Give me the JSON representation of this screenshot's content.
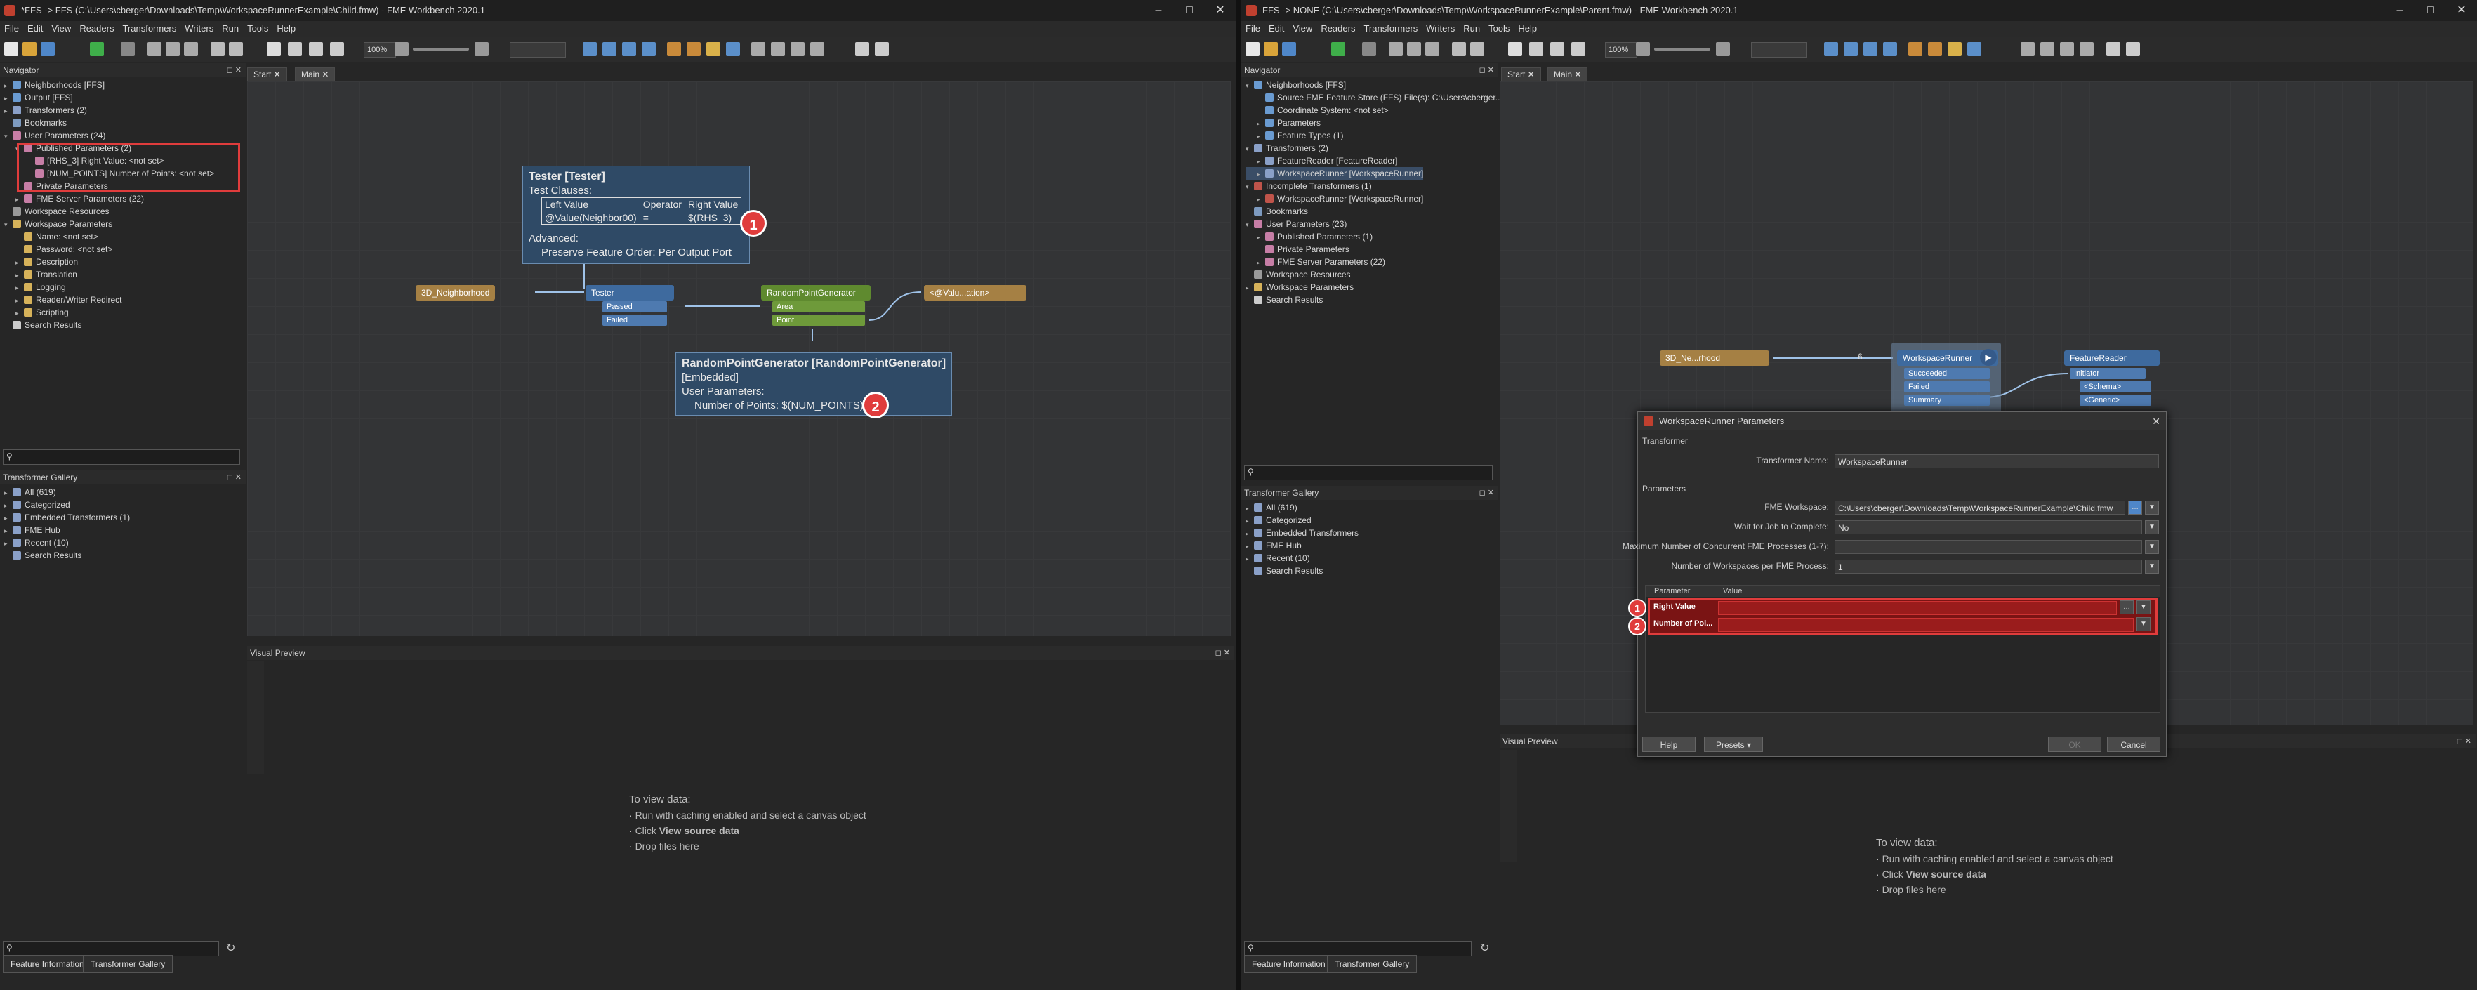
{
  "left": {
    "title": "*FFS -> FFS (C:\\Users\\cberger\\Downloads\\Temp\\WorkspaceRunnerExample\\Child.fmw) - FME Workbench 2020.1",
    "menu": [
      "File",
      "Edit",
      "View",
      "Readers",
      "Transformers",
      "Writers",
      "Run",
      "Tools",
      "Help"
    ],
    "zoom": "100%",
    "navigator_title": "Navigator",
    "nav": [
      {
        "label": "Neighborhoods [FFS]",
        "indent": 0,
        "arrow": "▸",
        "color": "#6a9bd1"
      },
      {
        "label": "Output [FFS]",
        "indent": 0,
        "arrow": "▸",
        "color": "#6a9bd1"
      },
      {
        "label": "Transformers (2)",
        "indent": 0,
        "arrow": "▸",
        "color": "#8aa0c8"
      },
      {
        "label": "Bookmarks",
        "indent": 0,
        "arrow": "",
        "color": "#7d9abf"
      },
      {
        "label": "User Parameters (24)",
        "indent": 0,
        "arrow": "▾",
        "color": "#c77ea6"
      },
      {
        "label": "Published Parameters (2)",
        "indent": 1,
        "arrow": "▾",
        "color": "#c77ea6"
      },
      {
        "label": "[RHS_3] Right Value: <not set>",
        "indent": 2,
        "arrow": "",
        "color": "#c77ea6"
      },
      {
        "label": "[NUM_POINTS] Number of Points: <not set>",
        "indent": 2,
        "arrow": "",
        "color": "#c77ea6"
      },
      {
        "label": "Private Parameters",
        "indent": 1,
        "arrow": "",
        "color": "#c77ea6"
      },
      {
        "label": "FME Server Parameters (22)",
        "indent": 1,
        "arrow": "▸",
        "color": "#c77ea6"
      },
      {
        "label": "Workspace Resources",
        "indent": 0,
        "arrow": "",
        "color": "#9a9a9a"
      },
      {
        "label": "Workspace Parameters",
        "indent": 0,
        "arrow": "▾",
        "color": "#d6b25a"
      },
      {
        "label": "Name: <not set>",
        "indent": 1,
        "arrow": "",
        "color": "#d6b25a"
      },
      {
        "label": "Password: <not set>",
        "indent": 1,
        "arrow": "",
        "color": "#d6b25a"
      },
      {
        "label": "Description",
        "indent": 1,
        "arrow": "▸",
        "color": "#d6b25a"
      },
      {
        "label": "Translation",
        "indent": 1,
        "arrow": "▸",
        "color": "#d6b25a"
      },
      {
        "label": "Logging",
        "indent": 1,
        "arrow": "▸",
        "color": "#d6b25a"
      },
      {
        "label": "Reader/Writer Redirect",
        "indent": 1,
        "arrow": "▸",
        "color": "#d6b25a"
      },
      {
        "label": "Scripting",
        "indent": 1,
        "arrow": "▸",
        "color": "#d6b25a"
      },
      {
        "label": "Search Results",
        "indent": 0,
        "arrow": "",
        "color": "#cccccc"
      }
    ],
    "gallery_title": "Transformer Gallery",
    "gallery": [
      {
        "label": "All (619)",
        "arrow": "▸"
      },
      {
        "label": "Categorized",
        "arrow": "▸"
      },
      {
        "label": "Embedded Transformers (1)",
        "arrow": "▸"
      },
      {
        "label": "FME Hub",
        "arrow": "▸"
      },
      {
        "label": "Recent (10)",
        "arrow": "▸"
      },
      {
        "label": "Search Results",
        "arrow": ""
      }
    ],
    "tabs": [
      "Start",
      "Main"
    ],
    "tester_ann": {
      "title": "Tester [Tester]",
      "clauses_label": "Test Clauses:",
      "headers": [
        "Left Value",
        "Operator",
        "Right Value"
      ],
      "row": [
        "@Value(Neighbor00)",
        "=",
        "$(RHS_3)"
      ],
      "advanced": "Advanced:",
      "preserve": "Preserve Feature Order: Per Output Port",
      "badge": "1"
    },
    "rpg_ann": {
      "title": "RandomPointGenerator [RandomPointGenerator]",
      "embedded": "[Embedded]",
      "user_params": "User Parameters:",
      "num_points": "Number of Points: $(NUM_POINTS)",
      "badge": "2"
    },
    "nodes": {
      "neighborhood": "3D_Neighborhood",
      "tester": "Tester",
      "passed": "Passed",
      "failed": "Failed",
      "rpg": "RandomPointGenerator",
      "area": "Area",
      "point": "Point",
      "writer": "<@Valu...ation>"
    },
    "visual_preview_title": "Visual Preview",
    "vp": {
      "heading": "To view data:",
      "l1": "Run with caching enabled and select a canvas object",
      "l2a": "Click",
      "l2b": "View source data",
      "l3": "Drop files here"
    },
    "bottom_tabs": [
      "Feature Information",
      "Transformer Gallery"
    ]
  },
  "right": {
    "title": "FFS -> NONE (C:\\Users\\cberger\\Downloads\\Temp\\WorkspaceRunnerExample\\Parent.fmw) - FME Workbench 2020.1",
    "menu": [
      "File",
      "Edit",
      "View",
      "Readers",
      "Transformers",
      "Writers",
      "Run",
      "Tools",
      "Help"
    ],
    "zoom": "100%",
    "navigator_title": "Navigator",
    "nav": [
      {
        "label": "Neighborhoods [FFS]",
        "indent": 0,
        "arrow": "▾",
        "color": "#6a9bd1"
      },
      {
        "label": "Source FME Feature Store (FFS) File(s): C:\\Users\\cberger...",
        "indent": 1,
        "arrow": "",
        "color": "#6a9bd1"
      },
      {
        "label": "Coordinate System: <not set>",
        "indent": 1,
        "arrow": "",
        "color": "#6a9bd1"
      },
      {
        "label": "Parameters",
        "indent": 1,
        "arrow": "▸",
        "color": "#6a9bd1"
      },
      {
        "label": "Feature Types (1)",
        "indent": 1,
        "arrow": "▸",
        "color": "#6a9bd1"
      },
      {
        "label": "Transformers (2)",
        "indent": 0,
        "arrow": "▾",
        "color": "#8aa0c8"
      },
      {
        "label": "FeatureReader [FeatureReader]",
        "indent": 1,
        "arrow": "▸",
        "color": "#8aa0c8"
      },
      {
        "label": "WorkspaceRunner [WorkspaceRunner]",
        "indent": 1,
        "arrow": "▸",
        "color": "#8aa0c8"
      },
      {
        "label": "Incomplete Transformers (1)",
        "indent": 0,
        "arrow": "▾",
        "color": "#c0544a"
      },
      {
        "label": "WorkspaceRunner [WorkspaceRunner]",
        "indent": 1,
        "arrow": "▸",
        "color": "#c0544a"
      },
      {
        "label": "Bookmarks",
        "indent": 0,
        "arrow": "",
        "color": "#7d9abf"
      },
      {
        "label": "User Parameters (23)",
        "indent": 0,
        "arrow": "▾",
        "color": "#c77ea6"
      },
      {
        "label": "Published Parameters (1)",
        "indent": 1,
        "arrow": "▸",
        "color": "#c77ea6"
      },
      {
        "label": "Private Parameters",
        "indent": 1,
        "arrow": "",
        "color": "#c77ea6"
      },
      {
        "label": "FME Server Parameters (22)",
        "indent": 1,
        "arrow": "▸",
        "color": "#c77ea6"
      },
      {
        "label": "Workspace Resources",
        "indent": 0,
        "arrow": "",
        "color": "#9a9a9a"
      },
      {
        "label": "Workspace Parameters",
        "indent": 0,
        "arrow": "▸",
        "color": "#d6b25a"
      },
      {
        "label": "Search Results",
        "indent": 0,
        "arrow": "",
        "color": "#cccccc"
      }
    ],
    "gallery_title": "Transformer Gallery",
    "gallery": [
      {
        "label": "All (619)",
        "arrow": "▸"
      },
      {
        "label": "Categorized",
        "arrow": "▸"
      },
      {
        "label": "Embedded Transformers",
        "arrow": "▸"
      },
      {
        "label": "FME Hub",
        "arrow": "▸"
      },
      {
        "label": "Recent (10)",
        "arrow": "▸"
      },
      {
        "label": "Search Results",
        "arrow": ""
      }
    ],
    "tabs": [
      "Start",
      "Main"
    ],
    "nodes": {
      "neighborhood": "3D_Ne...rhood",
      "count": "6",
      "runner": "WorkspaceRunner",
      "succeeded": "Succeeded",
      "failed": "Failed",
      "summary": "Summary",
      "reader": "FeatureReader",
      "initiator": "Initiator",
      "schema": "<Schema>",
      "generic": "<Generic>"
    },
    "dialog": {
      "title": "WorkspaceRunner Parameters",
      "section_transformer": "Transformer",
      "transformer_name_label": "Transformer Name:",
      "transformer_name_value": "WorkspaceRunner",
      "section_parameters": "Parameters",
      "fme_workspace_label": "FME Workspace:",
      "fme_workspace_value": "C:\\Users\\cberger\\Downloads\\Temp\\WorkspaceRunnerExample\\Child.fmw",
      "wait_label": "Wait for Job to Complete:",
      "wait_value": "No",
      "max_label": "Maximum Number of Concurrent FME Processes (1-7):",
      "max_value": "",
      "per_label": "Number of Workspaces per FME Process:",
      "per_value": "1",
      "col_param": "Parameter",
      "col_value": "Value",
      "row1": "Right Value",
      "row2": "Number of Poi...",
      "badge1": "1",
      "badge2": "2",
      "help": "Help",
      "presets": "Presets",
      "ok": "OK",
      "cancel": "Cancel"
    },
    "visual_preview_title": "Visual Preview",
    "vp": {
      "heading": "To view data:",
      "l1": "Run with caching enabled and select a canvas object",
      "l2a": "Click",
      "l2b": "View source data",
      "l3": "Drop files here"
    },
    "bottom_tabs": [
      "Feature Information",
      "Transformer Gallery"
    ]
  },
  "colors": {
    "highlight": "#e03c3c",
    "annotation": "#2f4a66",
    "reader_node": "#a58044",
    "transformer_node": "#3e6a9e",
    "rpg_node": "#5f8a2f",
    "selected_node": "#6f8aa8"
  }
}
